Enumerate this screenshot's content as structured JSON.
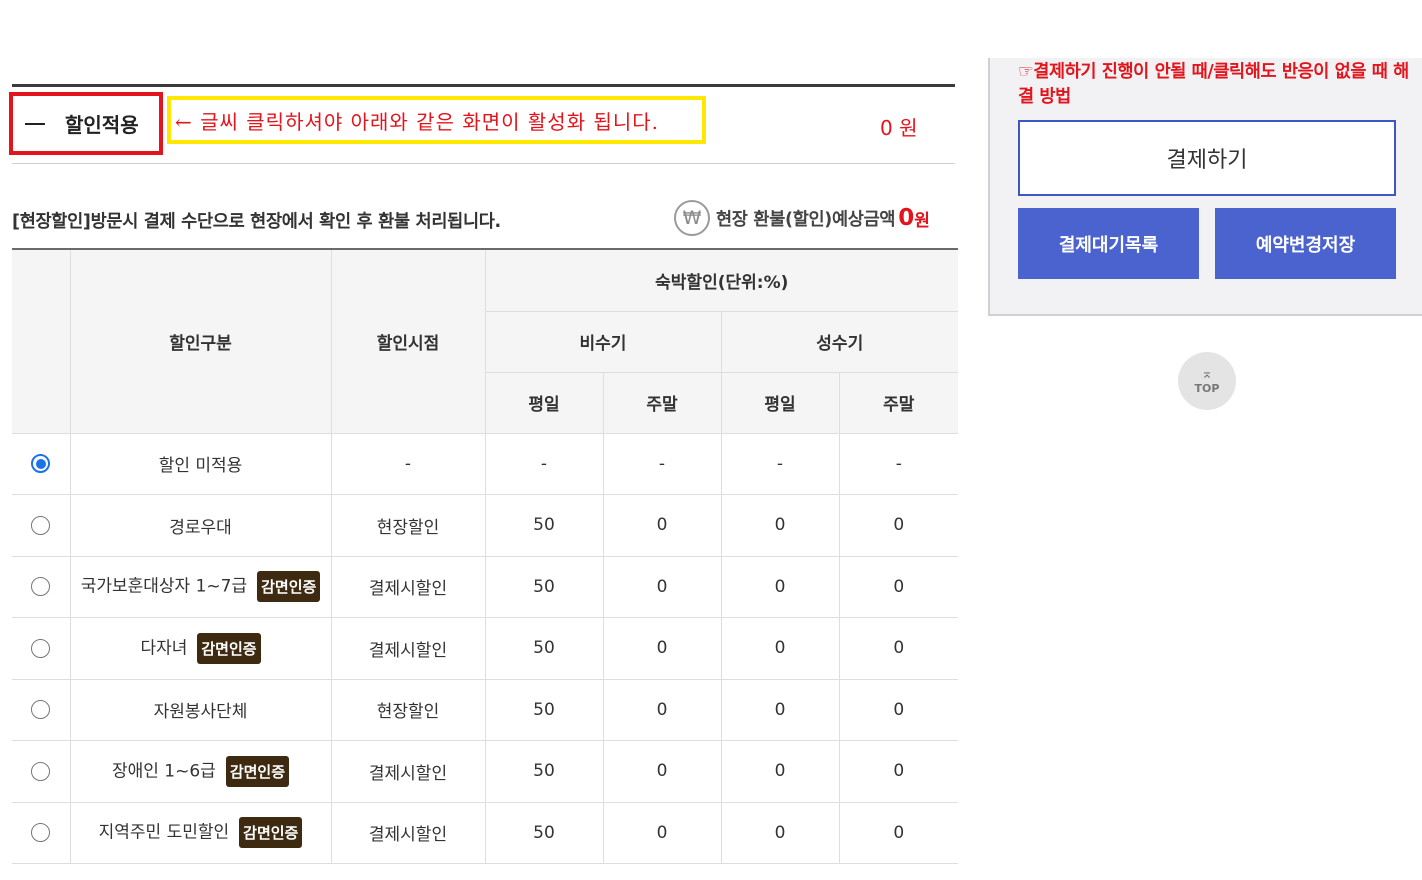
{
  "discount_section": {
    "toggle_label": "할인적용",
    "annotation": "← 글씨 클릭하셔야 아래와 같은 화면이 활성화 됩니다.",
    "price": "0 원",
    "onsite_note": "[현장할인]방문시 결제 수단으로 현장에서 확인 후 환불 처리됩니다.",
    "won_symbol": "₩",
    "refund_label": "현장 환불(할인)예상금액",
    "refund_value": "0",
    "refund_unit": "원"
  },
  "table": {
    "headers": {
      "type": "할인구분",
      "timing": "할인시점",
      "lodging": "숙박할인(단위:%)",
      "off_season": "비수기",
      "peak_season": "성수기",
      "weekday": "평일",
      "weekend": "주말"
    },
    "rows": [
      {
        "name": "할인 미적용",
        "badge": "",
        "timing": "-",
        "v1": "-",
        "v2": "-",
        "v3": "-",
        "v4": "-",
        "checked": true
      },
      {
        "name": "경로우대",
        "badge": "",
        "timing": "현장할인",
        "v1": "50",
        "v2": "0",
        "v3": "0",
        "v4": "0",
        "checked": false
      },
      {
        "name": "국가보훈대상자 1~7급",
        "badge": "감면인증",
        "timing": "결제시할인",
        "v1": "50",
        "v2": "0",
        "v3": "0",
        "v4": "0",
        "checked": false
      },
      {
        "name": "다자녀",
        "badge": "감면인증",
        "timing": "결제시할인",
        "v1": "50",
        "v2": "0",
        "v3": "0",
        "v4": "0",
        "checked": false
      },
      {
        "name": "자원봉사단체",
        "badge": "",
        "timing": "현장할인",
        "v1": "50",
        "v2": "0",
        "v3": "0",
        "v4": "0",
        "checked": false
      },
      {
        "name": "장애인 1~6급",
        "badge": "감면인증",
        "timing": "결제시할인",
        "v1": "50",
        "v2": "0",
        "v3": "0",
        "v4": "0",
        "checked": false
      },
      {
        "name": "지역주민 도민할인",
        "badge": "감면인증",
        "timing": "결제시할인",
        "v1": "50",
        "v2": "0",
        "v3": "0",
        "v4": "0",
        "checked": false
      }
    ]
  },
  "side_panel": {
    "help_text": "☞결제하기 진행이 안될 때/클릭해도 반응이 없을 때 해결 방법",
    "pay_button": "결제하기",
    "wait_list_button": "결제대기목록",
    "save_change_button": "예약변경저장"
  },
  "top_button": {
    "arrow": "⌅",
    "label": "TOP"
  },
  "colors": {
    "accent_red": "#e3141b",
    "highlight_yellow": "#ffe800",
    "primary_blue": "#4a63cf",
    "badge_brown": "#3e2a10"
  }
}
